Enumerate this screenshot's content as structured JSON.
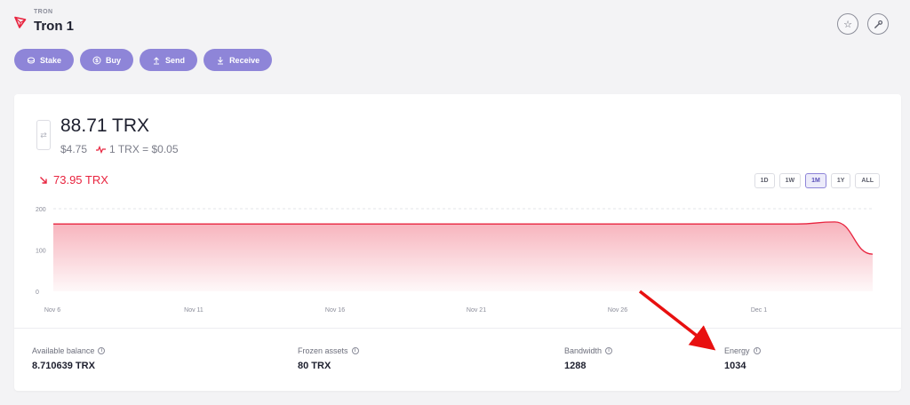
{
  "header": {
    "network": "TRON",
    "account_name": "Tron 1"
  },
  "actions": [
    {
      "label": "Stake",
      "icon": "stake-icon"
    },
    {
      "label": "Buy",
      "icon": "dollar-icon"
    },
    {
      "label": "Send",
      "icon": "upload-icon"
    },
    {
      "label": "Receive",
      "icon": "download-icon"
    }
  ],
  "balance": {
    "amount": "88.71 TRX",
    "fiat": "$4.75",
    "rate": "1 TRX = $0.05",
    "change": "73.95 TRX"
  },
  "ranges": [
    "1D",
    "1W",
    "1M",
    "1Y",
    "ALL"
  ],
  "active_range": "1M",
  "chart_data": {
    "type": "area",
    "x_ticks": [
      "Nov 6",
      "Nov 11",
      "Nov 16",
      "Nov 21",
      "Nov 26",
      "Dec 1"
    ],
    "y_ticks": [
      0,
      100,
      200
    ],
    "ylim": [
      0,
      200
    ],
    "series": [
      {
        "x": [
          "Nov 6",
          "Nov 11",
          "Nov 16",
          "Nov 21",
          "Nov 26",
          "Dec 1",
          "Dec 2",
          "Dec 3",
          "Dec 4"
        ],
        "values": [
          163,
          163,
          163,
          163,
          163,
          163,
          163,
          168,
          90
        ]
      }
    ],
    "color": "#e8243f"
  },
  "stats": [
    {
      "label": "Available balance",
      "value": "8.710639 TRX"
    },
    {
      "label": "Frozen assets",
      "value": "80 TRX"
    },
    {
      "label": "Bandwidth",
      "value": "1288"
    },
    {
      "label": "Energy",
      "value": "1034"
    }
  ],
  "colors": {
    "accent": "#8e85d8",
    "negative": "#e8243f",
    "annotation": "#e81010"
  }
}
